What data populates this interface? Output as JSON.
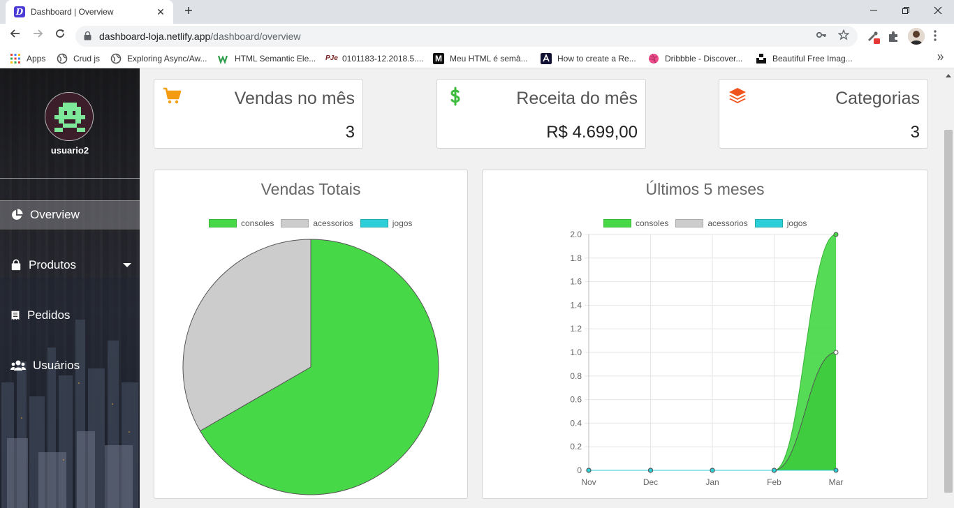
{
  "browser": {
    "tab_title": "Dashboard | Overview",
    "tab_favicon_letter": "D",
    "tab_close": "✕",
    "new_tab": "+",
    "url_host": "dashboard-loja.netlify.app",
    "url_path": "/dashboard/overview",
    "bookmarks": [
      {
        "label": "Apps",
        "icon": "apps-grid-icon",
        "color": "#e34133"
      },
      {
        "label": "Crud js",
        "icon": "globe-icon",
        "color": "#555555"
      },
      {
        "label": "Exploring Async/Aw...",
        "icon": "globe-icon",
        "color": "#555555"
      },
      {
        "label": "HTML Semantic Ele...",
        "icon": "w3schools-icon",
        "color": "#2e9c4a"
      },
      {
        "label": "0101183-12.2018.5....",
        "icon": "pje-icon",
        "color": "#7a2424"
      },
      {
        "label": "Meu HTML é semâ...",
        "icon": "medium-icon",
        "color": "#111111"
      },
      {
        "label": "How to create a Re...",
        "icon": "angular-icon",
        "color": "#111133"
      },
      {
        "label": "Dribbble - Discover...",
        "icon": "dribbble-icon",
        "color": "#ea4c89"
      },
      {
        "label": "Beautiful Free Imag...",
        "icon": "unsplash-icon",
        "color": "#111111"
      }
    ]
  },
  "sidebar": {
    "username": "usuario2",
    "items": [
      {
        "label": "Overview",
        "icon": "pie-chart-icon",
        "active": true
      },
      {
        "label": "Produtos",
        "icon": "shopping-bag-icon",
        "has_submenu": true
      },
      {
        "label": "Pedidos",
        "icon": "receipt-icon"
      },
      {
        "label": "Usuários",
        "icon": "users-icon"
      }
    ]
  },
  "stats": [
    {
      "title": "Vendas no mês",
      "value": "3",
      "icon": "shopping-cart-icon",
      "color": "#f39c12"
    },
    {
      "title": "Receita do mês",
      "value": "R$ 4.699,00",
      "icon": "dollar-icon",
      "color": "#3dbb3d"
    },
    {
      "title": "Categorias",
      "value": "3",
      "icon": "layers-icon",
      "color": "#f0541e"
    }
  ],
  "colors": {
    "consoles": "#47d847",
    "acessorios": "#cccccc",
    "jogos": "#2ccfd8"
  },
  "chart_data": [
    {
      "type": "pie",
      "title": "Vendas Totais",
      "categories": [
        "consoles",
        "acessorios",
        "jogos"
      ],
      "values": [
        2,
        1,
        0
      ],
      "legend": "top"
    },
    {
      "type": "area",
      "title": "Últimos 5 meses",
      "x": [
        "Nov",
        "Dec",
        "Jan",
        "Feb",
        "Mar"
      ],
      "series": [
        {
          "name": "consoles",
          "values": [
            0,
            0,
            0,
            0,
            2
          ]
        },
        {
          "name": "acessorios",
          "values": [
            0,
            0,
            0,
            0,
            1
          ]
        },
        {
          "name": "jogos",
          "values": [
            0,
            0,
            0,
            0,
            0
          ]
        }
      ],
      "ylim": [
        0,
        2
      ],
      "yticks": [
        "2.0",
        "1.8",
        "1.6",
        "1.4",
        "1.2",
        "1.0",
        "0.8",
        "0.6",
        "0.4",
        "0.2",
        "0"
      ],
      "grid": true,
      "legend": "top"
    }
  ]
}
